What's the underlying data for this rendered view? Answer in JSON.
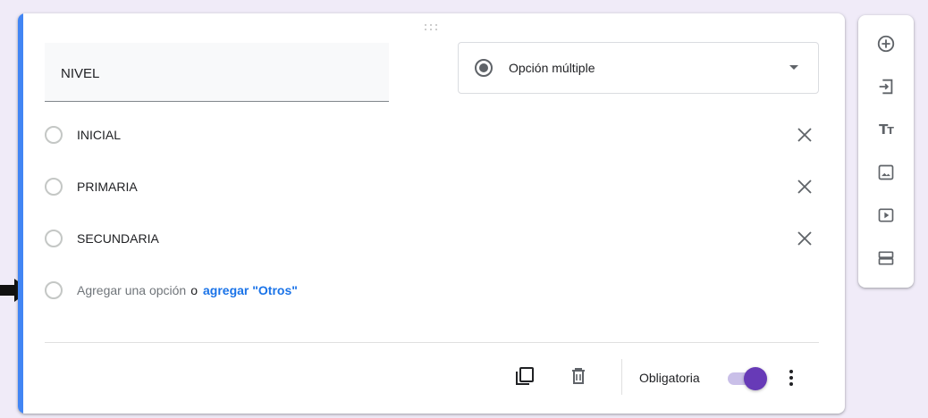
{
  "question": {
    "title_value": "NIVEL",
    "type_select": {
      "selected": "Opción múltiple"
    },
    "options": [
      {
        "label": "INICIAL"
      },
      {
        "label": "PRIMARIA"
      },
      {
        "label": "SECUNDARIA"
      }
    ],
    "add_option": {
      "text": "Agregar una opción",
      "or": "o",
      "add_other": "agregar \"Otros\""
    },
    "footer": {
      "required_label": "Obligatoria",
      "required_on": true
    }
  },
  "side_toolbar": {
    "items": [
      {
        "icon": "add-circle-icon"
      },
      {
        "icon": "import-questions-icon"
      },
      {
        "icon": "title-text-icon",
        "glyph": "Tт"
      },
      {
        "icon": "image-icon"
      },
      {
        "icon": "video-icon"
      },
      {
        "icon": "section-icon"
      }
    ]
  },
  "colors": {
    "accent": "#4285f4",
    "toggle": "#673ab7",
    "link": "#1a73e8",
    "background": "#f0ebf8"
  }
}
